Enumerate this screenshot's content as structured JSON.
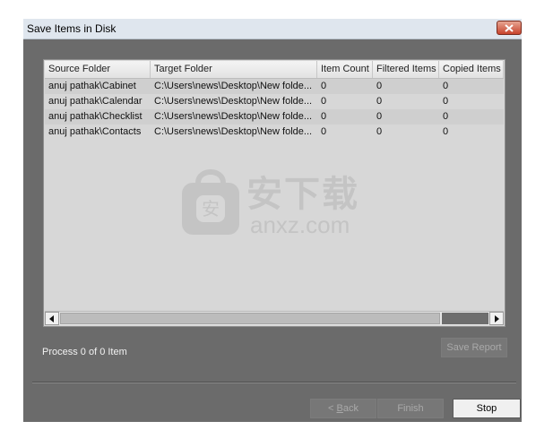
{
  "window": {
    "title": "Save Items in Disk",
    "close_icon": "close-icon"
  },
  "grid": {
    "columns": [
      "Source Folder",
      "Target Folder",
      "Item Count",
      "Filtered Items",
      "Copied Items"
    ],
    "rows": [
      [
        "anuj pathak\\Cabinet",
        "C:\\Users\\news\\Desktop\\New folde...",
        "0",
        "0",
        "0"
      ],
      [
        "anuj pathak\\Calendar",
        "C:\\Users\\news\\Desktop\\New folde...",
        "0",
        "0",
        "0"
      ],
      [
        "anuj pathak\\Checklist",
        "C:\\Users\\news\\Desktop\\New folde...",
        "0",
        "0",
        "0"
      ],
      [
        "anuj pathak\\Contacts",
        "C:\\Users\\news\\Desktop\\New folde...",
        "0",
        "0",
        "0"
      ]
    ]
  },
  "watermark": {
    "cn": "安下载",
    "en": "anxz.com",
    "badge": "安"
  },
  "status": {
    "text": "Process 0 of 0 Item"
  },
  "buttons": {
    "save_report": "Save Report",
    "back_mnemonic": "B",
    "back_prefix": "< ",
    "back_rest": "ack",
    "finish": "Finish",
    "stop": "Stop"
  }
}
